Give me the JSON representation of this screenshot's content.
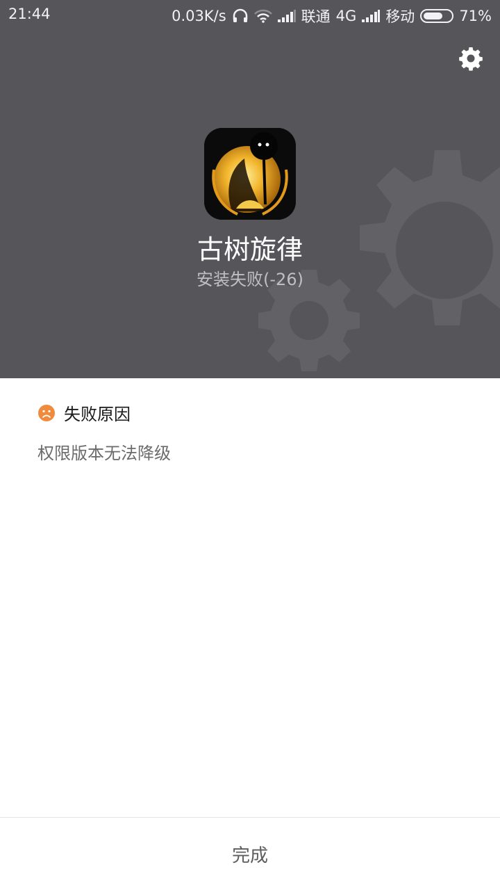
{
  "status_bar": {
    "time": "21:44",
    "speed": "0.03K/s",
    "carrier1": "联通",
    "network": "4G",
    "carrier2": "移动",
    "battery": "71%",
    "battery_level": 0.71
  },
  "header": {
    "settings_icon": "gear-icon",
    "app_name": "古树旋律",
    "install_status": "安装失败(-26)"
  },
  "failure": {
    "title": "失败原因",
    "title_icon": "sad-face-icon",
    "reason": "权限版本无法降级"
  },
  "footer": {
    "done_label": "完成"
  },
  "colors": {
    "header_bg": "#56555a",
    "gear_decor": "#6a696e",
    "accent_orange": "#f08b3e"
  }
}
